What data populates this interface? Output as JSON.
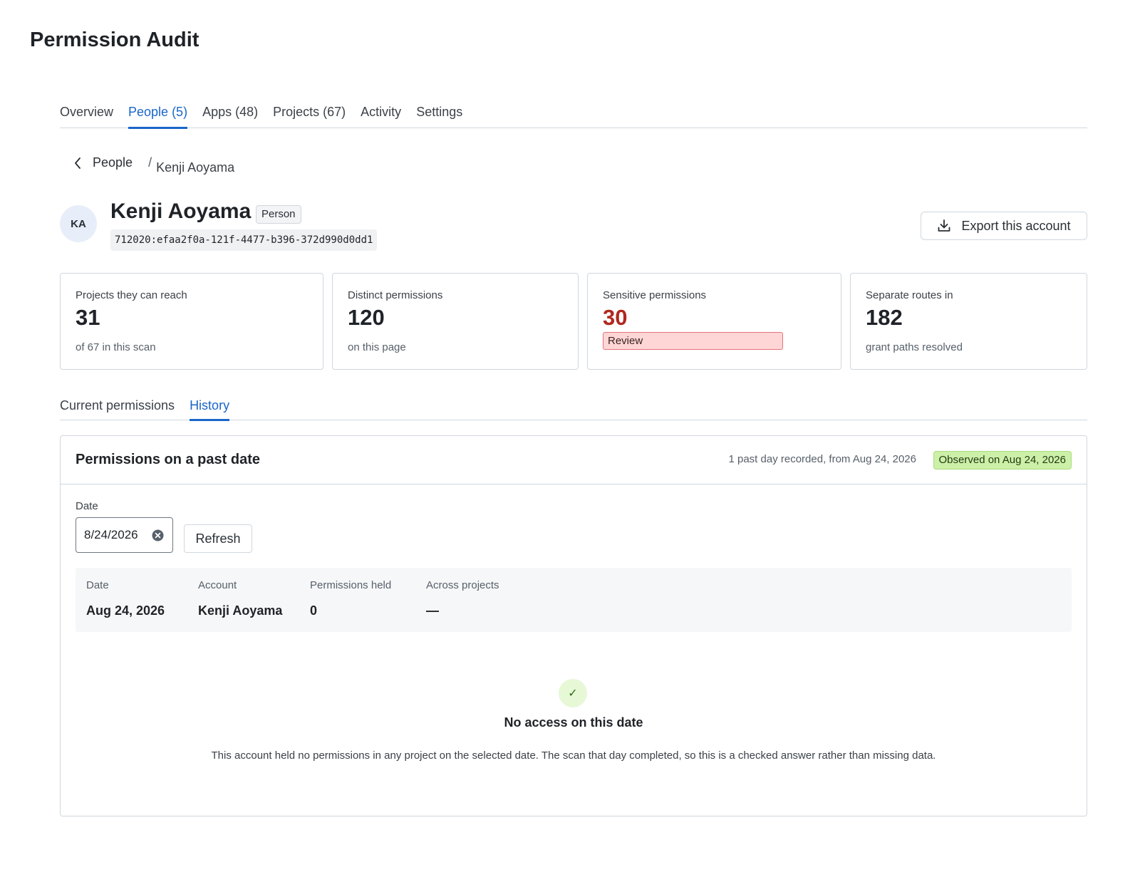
{
  "app": {
    "title": "Permission Audit"
  },
  "main_tabs": [
    {
      "label": "Overview",
      "active": false
    },
    {
      "label": "People (5)",
      "active": true
    },
    {
      "label": "Apps (48)",
      "active": false
    },
    {
      "label": "Projects (67)",
      "active": false
    },
    {
      "label": "Activity",
      "active": false
    },
    {
      "label": "Settings",
      "active": false
    }
  ],
  "breadcrumb": {
    "back_label": "People",
    "separator": "/",
    "current": "Kenji Aoyama"
  },
  "person": {
    "initials": "KA",
    "name": "Kenji Aoyama",
    "badge": "Person",
    "id": "712020:efaa2f0a-121f-4477-b396-372d990d0dd1"
  },
  "export_button": {
    "label": "Export this account",
    "icon": "download-icon"
  },
  "stats": [
    {
      "label": "Projects they can reach",
      "value": "31",
      "sub": "of 67 in this scan"
    },
    {
      "label": "Distinct permissions",
      "value": "120",
      "sub": "on this page"
    },
    {
      "label": "Sensitive permissions",
      "value": "30",
      "pill": "Review",
      "color": "#b0281f"
    },
    {
      "label": "Separate routes in",
      "value": "182",
      "sub": "grant paths resolved"
    }
  ],
  "sub_tabs": [
    {
      "label": "Current permissions",
      "active": false
    },
    {
      "label": "History",
      "active": true
    }
  ],
  "history": {
    "title": "Permissions on a past date",
    "meta": "1 past day recorded, from Aug 24, 2026",
    "observed": "Observed on Aug 24, 2026",
    "date_label": "Date",
    "date_value": "8/24/2026",
    "refresh_label": "Refresh",
    "summary": {
      "headers": [
        "Date",
        "Account",
        "Permissions held",
        "Across projects"
      ],
      "values": [
        "Aug 24, 2026",
        "Kenji Aoyama",
        "0",
        "—"
      ]
    },
    "empty_state": {
      "icon": "check-icon",
      "glyph": "✓",
      "title": "No access on this date",
      "text": "This account held no permissions in any project on the selected date. The scan that day completed, so this is a checked answer rather than missing data."
    }
  },
  "colors": {
    "accent": "#1a66c9",
    "danger": "#b0281f",
    "success_bg": "#cdf0a8"
  }
}
